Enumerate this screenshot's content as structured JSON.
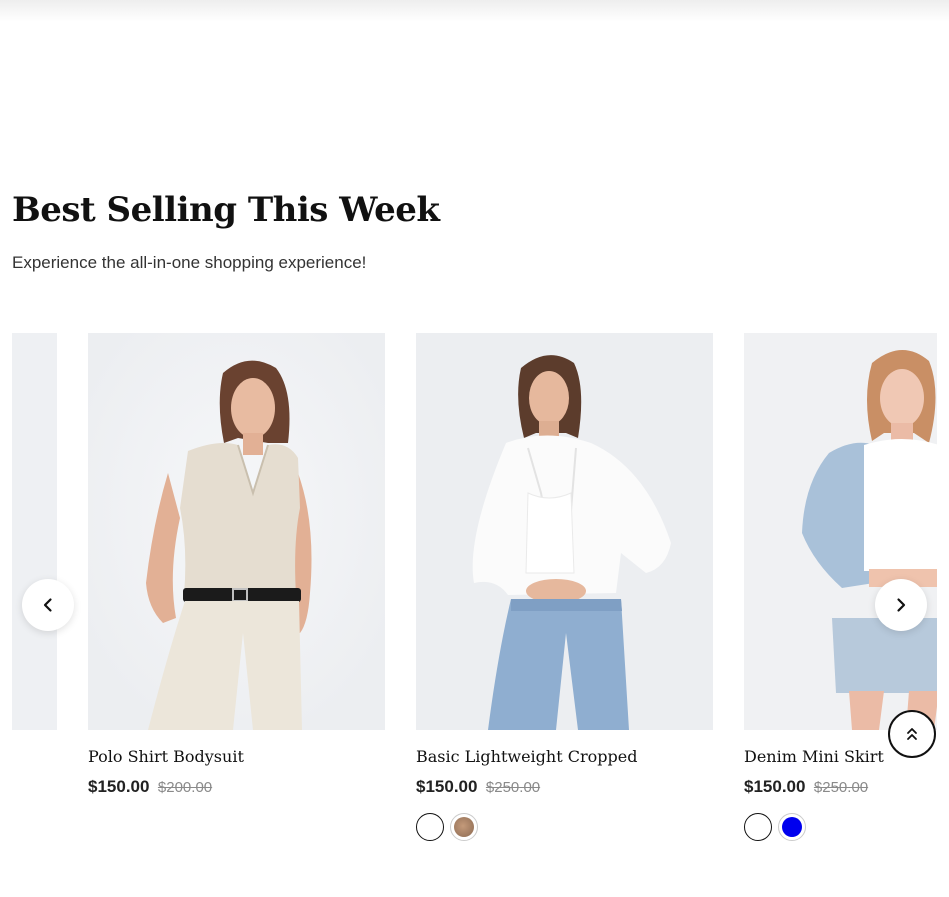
{
  "section": {
    "title": "Best Selling This Week",
    "subtitle": "Experience the all-in-one shopping experience!"
  },
  "products": [
    {
      "name": "Polo Shirt Bodysuit",
      "price": "$150.00",
      "old_price": "$200.00",
      "swatches": []
    },
    {
      "name": "Basic Lightweight Cropped",
      "price": "$150.00",
      "old_price": "$250.00",
      "swatches": [
        {
          "color": "#ffffff",
          "selected": true
        },
        {
          "color": "#a07f67",
          "selected": false
        }
      ]
    },
    {
      "name": "Denim Mini Skirt",
      "price": "$150.00",
      "old_price": "$250.00",
      "swatches": [
        {
          "color": "#ffffff",
          "selected": true
        },
        {
          "color": "#0000ee",
          "selected": false
        }
      ]
    }
  ],
  "icons": {
    "prev": "chevron-left-icon",
    "next": "chevron-right-icon",
    "scroll_top": "double-chevron-up-icon"
  }
}
